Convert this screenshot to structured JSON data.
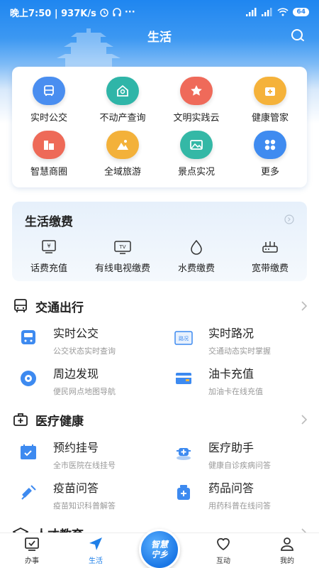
{
  "status_bar": {
    "time_speed": "晚上7:50 | 937K/s",
    "battery": "64"
  },
  "header": {
    "title": "生活"
  },
  "quick_grid": [
    {
      "label": "实时公交",
      "color": "#4a8ef0",
      "icon": "bus-icon"
    },
    {
      "label": "不动产查询",
      "color": "#2fb5a8",
      "icon": "house-search-icon"
    },
    {
      "label": "文明实践云",
      "color": "#ef6a5a",
      "icon": "star-badge-icon"
    },
    {
      "label": "健康管家",
      "color": "#f5b23a",
      "icon": "medical-kit-icon"
    },
    {
      "label": "智慧商圈",
      "color": "#ee6a58",
      "icon": "shop-icon"
    },
    {
      "label": "全域旅游",
      "color": "#f3b13a",
      "icon": "mountain-icon"
    },
    {
      "label": "景点实况",
      "color": "#34b8a6",
      "icon": "landscape-icon"
    },
    {
      "label": "更多",
      "color": "#3f8bf0",
      "icon": "more-grid-icon"
    }
  ],
  "life_pay": {
    "title": "生活缴费",
    "items": [
      {
        "label": "话费充值",
        "icon": "phone-bill-icon"
      },
      {
        "label": "有线电视缴费",
        "icon": "tv-icon"
      },
      {
        "label": "水费缴费",
        "icon": "water-drop-icon"
      },
      {
        "label": "宽带缴费",
        "icon": "router-icon"
      }
    ]
  },
  "traffic": {
    "title": "交通出行",
    "items": [
      {
        "name": "实时公交",
        "desc": "公交状态实时查询",
        "icon": "bus-icon"
      },
      {
        "name": "实时路况",
        "desc": "交通动态实时掌握",
        "icon": "road-sign-icon",
        "badge": "路况"
      },
      {
        "name": "周边发现",
        "desc": "便民网点地图导航",
        "icon": "compass-icon"
      },
      {
        "name": "油卡充值",
        "desc": "加油卡在线充值",
        "icon": "card-icon"
      }
    ]
  },
  "medical": {
    "title": "医疗健康",
    "items": [
      {
        "name": "预约挂号",
        "desc": "全市医院在线挂号",
        "icon": "calendar-check-icon"
      },
      {
        "name": "医疗助手",
        "desc": "健康自诊疾病问答",
        "icon": "doctor-assistant-icon"
      },
      {
        "name": "疫苗问答",
        "desc": "疫苗知识科普解答",
        "icon": "syringe-icon"
      },
      {
        "name": "药品问答",
        "desc": "用药科普在线问答",
        "icon": "medicine-bottle-icon"
      }
    ]
  },
  "education": {
    "title": "人才教育"
  },
  "tabbar": {
    "items": [
      {
        "label": "办事"
      },
      {
        "label": "生活"
      },
      {
        "label": "互动"
      },
      {
        "label": "我的"
      }
    ],
    "center_line1": "智慧",
    "center_line2": "宁乡"
  },
  "colors": {
    "accent": "#1e7fe8",
    "text": "#222222",
    "subtext": "#999999"
  }
}
